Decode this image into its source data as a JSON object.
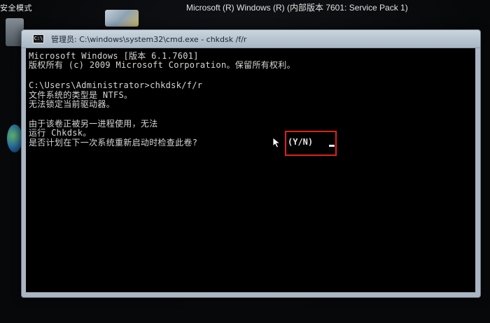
{
  "desktop": {
    "safe_mode_label": "安全模式",
    "os_version_label": "Microsoft (R) Windows (R) (内部版本 7601: Service Pack 1)"
  },
  "window": {
    "title": "管理员: C:\\windows\\system32\\cmd.exe - chkdsk /f/r",
    "icon_label": "C:\\"
  },
  "console": {
    "lines": [
      "Microsoft Windows [版本 6.1.7601]",
      "版权所有 (c) 2009 Microsoft Corporation。保留所有权利。",
      "C:\\Users\\Administrator>chkdsk/f/r",
      "文件系统的类型是 NTFS。",
      "无法锁定当前驱动器。",
      "由于该卷正被另一进程使用，无法",
      "运行 Chkdsk。",
      "是否计划在下一次系统重新启动时检查此卷?"
    ],
    "prompt": "(Y/N)"
  },
  "colors": {
    "console_background": "#000000",
    "console_text": "#d6d6d6",
    "highlight_border": "#e01f1f",
    "titlebar": "#b8c4d0"
  },
  "icons": {
    "window_icon": "cmd-icon",
    "pointer": "mouse-pointer-icon"
  }
}
